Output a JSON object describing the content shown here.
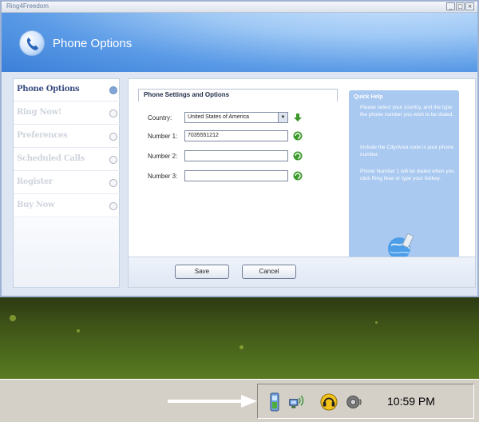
{
  "window": {
    "title": "Ring4Freedom",
    "buttons": [
      "_",
      "□",
      "×"
    ],
    "header_title": "Phone Options"
  },
  "sidebar": {
    "items": [
      {
        "label": "Phone Options",
        "active": true
      },
      {
        "label": "Ring Now!",
        "active": false
      },
      {
        "label": "Preferences",
        "active": false
      },
      {
        "label": "Scheduled Calls",
        "active": false
      },
      {
        "label": "Register",
        "active": false
      },
      {
        "label": "Buy Now",
        "active": false
      }
    ]
  },
  "form": {
    "section_title": "Phone Settings and Options",
    "country_label": "Country:",
    "country_value": "United States of America",
    "number1_label": "Number 1:",
    "number1_value": "7035551212",
    "number2_label": "Number 2:",
    "number2_value": "",
    "number3_label": "Number 3:",
    "number3_value": ""
  },
  "buttons": {
    "save": "Save",
    "cancel": "Cancel"
  },
  "quick_help": {
    "title": "Quick Help",
    "para1": "Please select your country, and the type the phone number you wish to be dialed.",
    "para2": "Include the City/Area code is your phone number.",
    "para3": "Phone Number 1 will be dialed when you click Ring Now or type your hotkey."
  },
  "taskbar": {
    "clock": "10:59 PM",
    "tray_icons": [
      "phone-app-icon",
      "network-wireless-icon",
      "headset-icon",
      "speaker-icon"
    ]
  },
  "colors": {
    "header_blue": "#3b7fd8",
    "quickhelp_blue": "#a9c9f0",
    "go_green": "#3c9a2a"
  }
}
